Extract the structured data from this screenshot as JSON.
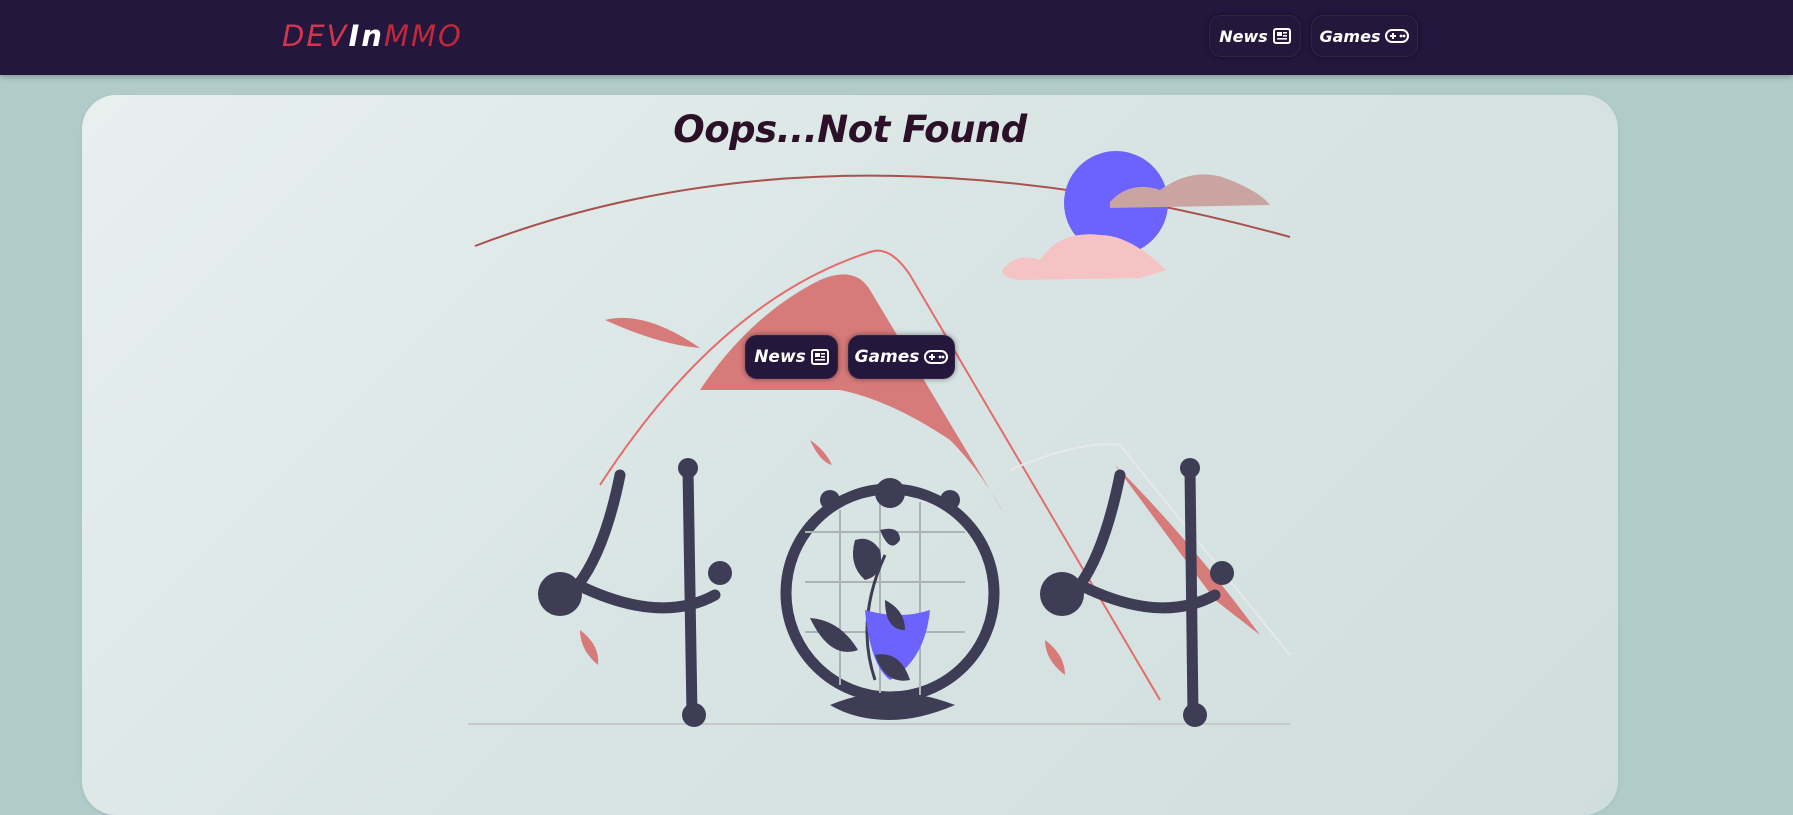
{
  "header": {
    "logo": {
      "part1": "DEV",
      "part2": "In",
      "part3": "MMO"
    },
    "nav": [
      {
        "label": "News",
        "icon": "newspaper-icon"
      },
      {
        "label": "Games",
        "icon": "gamepad-icon"
      }
    ]
  },
  "main": {
    "title": "Oops...Not Found",
    "illustration": "404",
    "buttons": [
      {
        "label": "News",
        "icon": "newspaper-icon"
      },
      {
        "label": "Games",
        "icon": "gamepad-icon"
      }
    ]
  },
  "colors": {
    "header_bg": "#23173e",
    "page_bg": "#b1cbcb",
    "accent_red": "#d2364e",
    "illustration_dark": "#3f3d56",
    "illustration_purple": "#6c63ff",
    "illustration_coral": "#d77a7a"
  }
}
